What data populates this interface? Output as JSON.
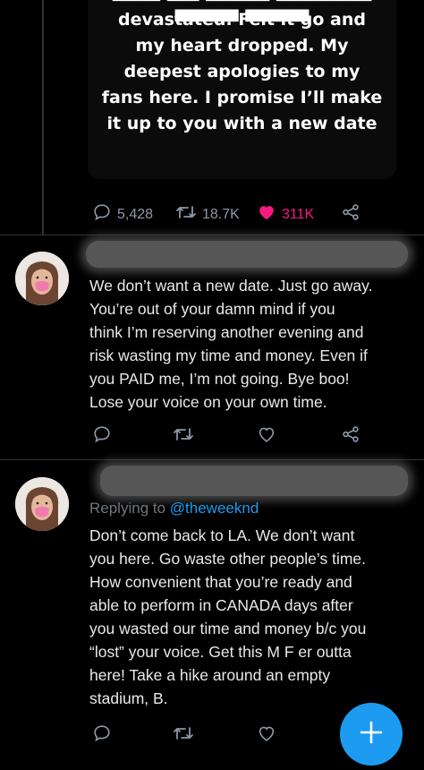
{
  "main_tweet": {
    "media_caption_lines": [
      "devastated. Felt it go and",
      "my heart dropped. My",
      "deepest apologies to my",
      "fans here. I promise I’ll make",
      "it up to you with a new date"
    ],
    "stats": {
      "replies": "5,428",
      "retweets": "18.7K",
      "likes": "311K"
    },
    "liked": true,
    "like_color": "#f91880"
  },
  "replies": [
    {
      "text_lines": [
        "We don’t want a new date. Just go away.",
        "You’re out of your damn mind if you",
        "think I’m reserving another evening and",
        "risk wasting my time and money. Even if",
        "you PAID me, I’m not going. Bye boo!",
        "Lose your voice on your own time."
      ],
      "icons": [
        "reply-icon",
        "retweet-icon",
        "like-icon",
        "share-icon"
      ]
    },
    {
      "replying_to_label": "Replying to",
      "replying_to_handle": "@theweeknd",
      "text_lines": [
        "Don’t come back to LA. We don’t want",
        "you here. Go waste other people’s time.",
        "How convenient that you’re ready and",
        "able to perform in CANADA days after",
        "you wasted our time and money b/c you",
        "“lost” your voice. Get this M F er outta",
        "here! Take a hike around an empty",
        "stadium, B."
      ],
      "icons": [
        "reply-icon",
        "retweet-icon",
        "like-icon"
      ]
    }
  ],
  "compose_button": {
    "icon": "plus-icon",
    "color": "#1d9bf0"
  },
  "colors": {
    "muted": "#8b98a5",
    "text": "#e7e9ea",
    "accent": "#1d9bf0",
    "divider": "#2f3336"
  }
}
